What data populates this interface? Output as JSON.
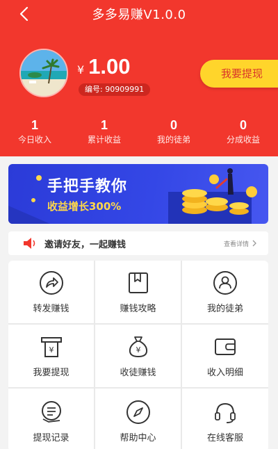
{
  "topbar": {
    "title": "多多易赚V1.0.0"
  },
  "account": {
    "currency": "¥",
    "balance": "1.00",
    "member_id": "编号: 90909991",
    "withdraw_label": "我要提现"
  },
  "stats": [
    {
      "value": "1",
      "label": "今日收入"
    },
    {
      "value": "1",
      "label": "累计收益"
    },
    {
      "value": "0",
      "label": "我的徒弟"
    },
    {
      "value": "0",
      "label": "分成收益"
    }
  ],
  "banner": {
    "title": "手把手教你",
    "subtitle": "收益增长300%"
  },
  "notice": {
    "text": "邀请好友，一起赚钱",
    "more": "查看详情"
  },
  "menu": [
    {
      "label": "转发赚钱",
      "icon": "share-icon"
    },
    {
      "label": "赚钱攻略",
      "icon": "bookmark-icon"
    },
    {
      "label": "我的徒弟",
      "icon": "user-icon"
    },
    {
      "label": "我要提现",
      "icon": "atm-icon"
    },
    {
      "label": "收徒赚钱",
      "icon": "money-bag-icon"
    },
    {
      "label": "收入明细",
      "icon": "wallet-icon"
    },
    {
      "label": "提现记录",
      "icon": "record-icon"
    },
    {
      "label": "帮助中心",
      "icon": "compass-icon"
    },
    {
      "label": "在线客服",
      "icon": "headset-icon"
    }
  ],
  "colors": {
    "brand": "#f2372d",
    "accent": "#ffd52b",
    "banner": "#3447e6"
  }
}
